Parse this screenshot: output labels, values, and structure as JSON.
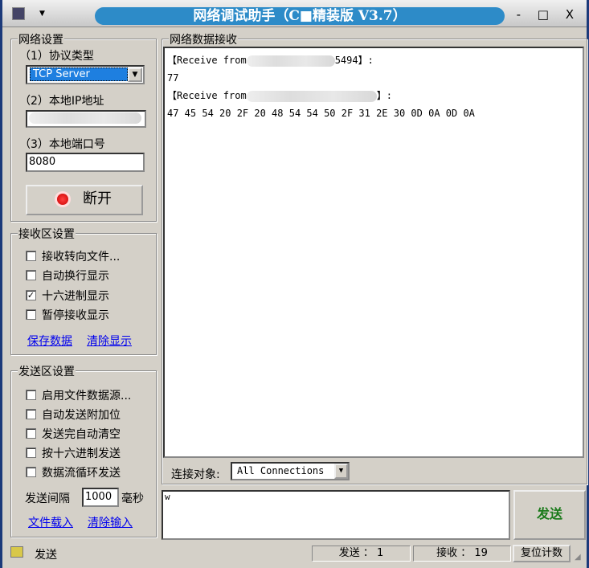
{
  "window": {
    "title": "网络调试助手（C■精装版 V3.7）",
    "controls": "- □ X"
  },
  "network": {
    "legend": "网络设置",
    "protocol_label": "（1）协议类型",
    "protocol_value": "TCP Server",
    "ip_label": "（2）本地IP地址",
    "port_label": "（3）本地端口号",
    "port_value": "8080",
    "disconnect_label": "断开"
  },
  "recv_settings": {
    "legend": "接收区设置",
    "options": [
      {
        "label": "接收转向文件...",
        "checked": false
      },
      {
        "label": "自动换行显示",
        "checked": false
      },
      {
        "label": "十六进制显示",
        "checked": true
      },
      {
        "label": "暂停接收显示",
        "checked": false
      }
    ],
    "save_link": "保存数据",
    "clear_link": "清除显示"
  },
  "send_settings": {
    "legend": "发送区设置",
    "options": [
      {
        "label": "启用文件数据源...",
        "checked": false
      },
      {
        "label": "自动发送附加位",
        "checked": false
      },
      {
        "label": "发送完自动清空",
        "checked": false
      },
      {
        "label": "按十六进制发送",
        "checked": false
      },
      {
        "label": "数据流循环发送",
        "checked": false
      }
    ],
    "interval_label": "发送间隔",
    "interval_value": "1000",
    "interval_unit": "毫秒",
    "load_link": "文件载入",
    "clear_link": "清除输入"
  },
  "receive": {
    "legend": "网络数据接收",
    "lines": [
      {
        "prefix": "【Receive from",
        "suffix": "5494】:"
      },
      {
        "text": "77"
      },
      {
        "prefix": "【Receive from",
        "suffix": "】:"
      },
      {
        "text": "47 45 54 20 2F 20 48 54 54 50 2F 31 2E 30 0D 0A 0D 0A"
      }
    ]
  },
  "target": {
    "label": "连接对象:",
    "value": "All Connections"
  },
  "send": {
    "input_value": "w",
    "button_label": "发送"
  },
  "statusbar": {
    "mode": "发送",
    "sent": "发送 ： 1",
    "received": "接收 ： 19",
    "reset_label": "复位计数"
  }
}
